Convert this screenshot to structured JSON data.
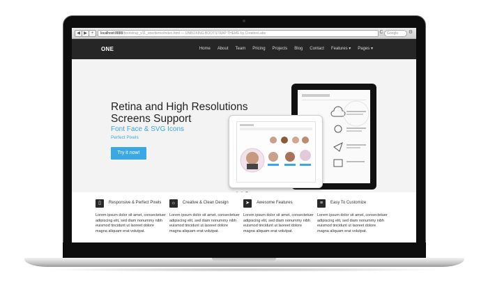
{
  "browser": {
    "back": "◀",
    "forward": "▶",
    "add": "+",
    "url_host": "localhost:8888",
    "url_path": "/bootstrap_v11_one/demo/index.html",
    "url_title": " — UNBOXING BOOTSTRAP THEME by CreativeLabs",
    "search_placeholder": "Google",
    "refresh": "C"
  },
  "navbar": {
    "brand": "ONE",
    "items": [
      "Home",
      "About",
      "Team",
      "Pricing",
      "Projects",
      "Blog",
      "Contact",
      "Features ▾",
      "Pages ▾"
    ]
  },
  "hero": {
    "title": "Retina and High Resolutions Screens Support",
    "subtitle": "Font Face & SVG Icons",
    "tagline": "Perfect Pixels",
    "button": "Try it now!"
  },
  "carousel": {
    "slides": 3,
    "active": 3
  },
  "features": [
    {
      "icon": "tablet-icon",
      "glyph": "▯",
      "title": "Responsive & Perfect Pixels",
      "text": "Lorem ipsum dolor sit amet, consectetuer adipiscing elit, sed diam nonummy nibh euismod tincidunt ut laoreet dolore magna aliquam erat volutpat."
    },
    {
      "icon": "lightbulb-icon",
      "glyph": "☼",
      "title": "Creative & Clean Design",
      "text": "Lorem ipsum dolor sit amet, consectetuer adipiscing elit, sed diam nonummy nibh euismod tincidunt ut laoreet dolore magna aliquam erat volutpat."
    },
    {
      "icon": "paper-plane-icon",
      "glyph": "➤",
      "title": "Awesome Features",
      "text": "Lorem ipsum dolor sit amet, consectetuer adipiscing elit, sed diam nonummy nibh euismod tincidunt ut laoreet dolore magna aliquam erat volutpat."
    },
    {
      "icon": "sliders-icon",
      "glyph": "≡",
      "title": "Easy To Customize",
      "text": "Lorem ipsum dolor sit amet, consectetuer adipiscing elit, sed diam nonummy nibh euismod tincidunt ut laoreet dolore magna aliquam erat volutpat."
    }
  ],
  "colors": {
    "accent": "#3aa8e4",
    "navbar": "#262626",
    "hero_bg": "#f3f3f3"
  }
}
